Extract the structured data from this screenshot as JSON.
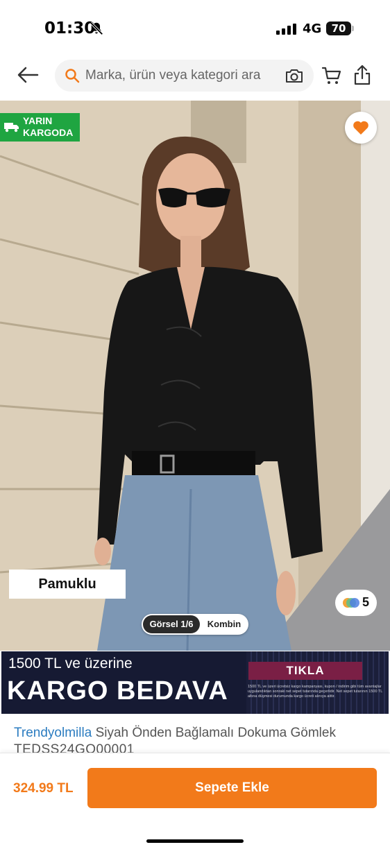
{
  "status_bar": {
    "time": "01:30",
    "network": "4G",
    "battery": "70"
  },
  "search": {
    "placeholder": "Marka, ürün veya kategori ara"
  },
  "product": {
    "cargo_badge": "YARIN\nKARGODA",
    "feature_tag": "Pamuklu",
    "color_count": "5",
    "view_tabs": [
      "Görsel 1/6",
      "Kombin"
    ],
    "brand": "Trendyolmilla",
    "title": "Siyah Önden Bağlamalı Dokuma Gömlek",
    "code": "TEDSS24GO00001",
    "price": "324.99 TL",
    "add_to_cart_label": "Sepete Ekle"
  },
  "promo": {
    "line1": "1500 TL ve üzerine",
    "line2": "KARGO BEDAVA",
    "cta": "TIKLA",
    "small_print": "1500 TL ve üzeri ücretsiz kargo kampanyası, kupon / indirim gibi tüm avantajlar uygulandıktan sonraki net sepet tutarında geçerlidir. Net sepet tutarının 1500 TL altına düşmesi durumunda kargo ücreti alınıya aittir."
  },
  "colors": {
    "accent": "#f27a1a",
    "cargo_green": "#1fa541",
    "brand_blue": "#2b7cc0",
    "promo_bg": "#161a33"
  },
  "icons": [
    "bell-off-icon",
    "signal-icon",
    "battery-icon",
    "back-arrow-icon",
    "search-icon",
    "camera-icon",
    "cart-icon",
    "share-icon",
    "truck-icon",
    "heart-icon",
    "color-dots-icon"
  ]
}
